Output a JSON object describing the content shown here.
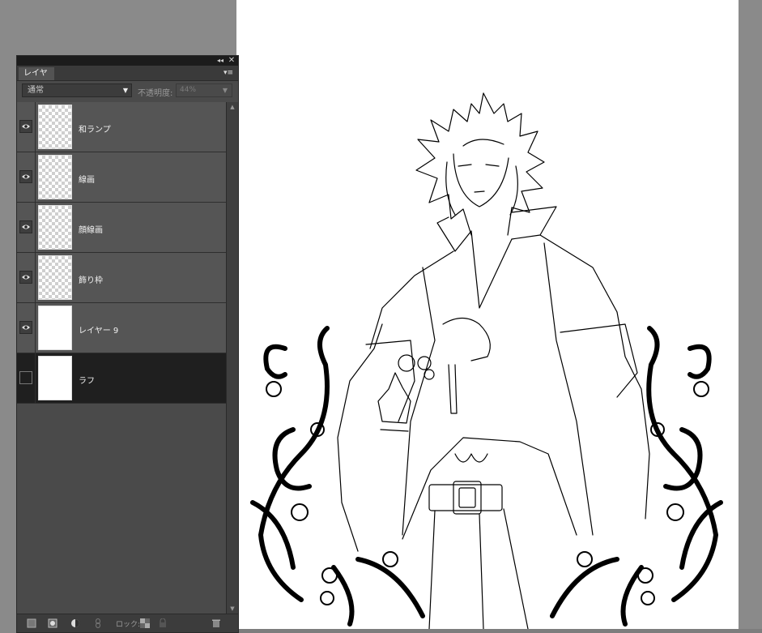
{
  "panel": {
    "tab_label": "レイヤー",
    "blend_mode": "通常",
    "opacity_label": "不透明度:",
    "opacity_value": "44%",
    "lock_label": "ロック:",
    "layers": [
      {
        "name": "和ランプ",
        "visible": true,
        "selected": false,
        "thumb": "transparent"
      },
      {
        "name": "線画",
        "visible": true,
        "selected": false,
        "thumb": "transparent"
      },
      {
        "name": "顔線画",
        "visible": true,
        "selected": false,
        "thumb": "transparent"
      },
      {
        "name": "飾り枠",
        "visible": true,
        "selected": false,
        "thumb": "transparent"
      },
      {
        "name": "レイヤー 9",
        "visible": true,
        "selected": false,
        "thumb": "white"
      },
      {
        "name": "ラフ",
        "visible": false,
        "selected": true,
        "thumb": "white"
      }
    ]
  },
  "icons": {
    "visibility": "eye-icon",
    "collapse": "double-chevron-icon",
    "close": "close-icon",
    "menu": "panel-menu-icon",
    "new_layer": "new-layer-icon",
    "mask": "layer-mask-icon",
    "adjustment": "adjustment-layer-icon",
    "link": "link-icon",
    "lock_transparency": "lock-transparency-icon",
    "lock_all": "lock-icon",
    "delete": "trash-icon"
  },
  "colors": {
    "panel_bg": "#4a4a4a",
    "layer_bg": "#555555",
    "selected_layer_bg": "#1f1f1f",
    "workspace_bg": "#8a8a8a",
    "canvas_bg": "#ffffff"
  }
}
